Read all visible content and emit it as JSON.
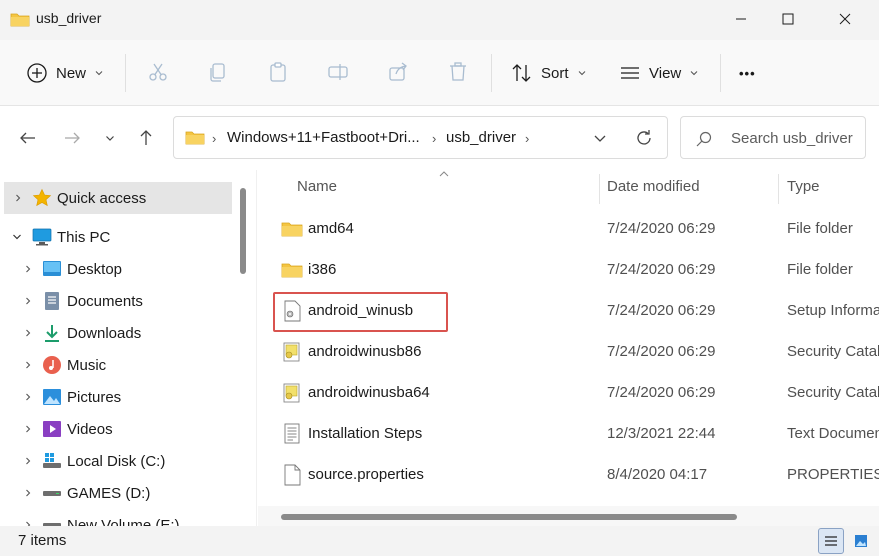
{
  "window": {
    "title": "usb_driver"
  },
  "toolbar": {
    "new_label": "New",
    "sort_label": "Sort",
    "view_label": "View",
    "more_label": "•••"
  },
  "address": {
    "crumbs": [
      "Windows+11+Fastboot+Dri...",
      "usb_driver"
    ],
    "search_placeholder": "Search usb_driver"
  },
  "nav": {
    "items": [
      {
        "label": "Quick access",
        "icon": "star-icon"
      },
      {
        "label": "This PC",
        "icon": "computer-icon"
      },
      {
        "label": "Desktop",
        "icon": "desktop-icon"
      },
      {
        "label": "Documents",
        "icon": "documents-icon"
      },
      {
        "label": "Downloads",
        "icon": "downloads-icon"
      },
      {
        "label": "Music",
        "icon": "music-icon"
      },
      {
        "label": "Pictures",
        "icon": "pictures-icon"
      },
      {
        "label": "Videos",
        "icon": "videos-icon"
      },
      {
        "label": "Local Disk (C:)",
        "icon": "disk-icon"
      },
      {
        "label": "GAMES (D:)",
        "icon": "disk-icon"
      },
      {
        "label": "New Volume (E:)",
        "icon": "disk-icon"
      }
    ]
  },
  "columns": {
    "name": "Name",
    "date": "Date modified",
    "type": "Type"
  },
  "files": [
    {
      "name": "amd64",
      "date": "7/24/2020 06:29",
      "type": "File folder",
      "icon": "folder-icon"
    },
    {
      "name": "i386",
      "date": "7/24/2020 06:29",
      "type": "File folder",
      "icon": "folder-icon"
    },
    {
      "name": "android_winusb",
      "date": "7/24/2020 06:29",
      "type": "Setup Informa",
      "icon": "setup-file-icon"
    },
    {
      "name": "androidwinusb86",
      "date": "7/24/2020 06:29",
      "type": "Security Catalo",
      "icon": "security-catalog-icon"
    },
    {
      "name": "androidwinusba64",
      "date": "7/24/2020 06:29",
      "type": "Security Catalo",
      "icon": "security-catalog-icon"
    },
    {
      "name": "Installation Steps",
      "date": "12/3/2021 22:44",
      "type": "Text Documen",
      "icon": "text-document-icon"
    },
    {
      "name": "source.properties",
      "date": "8/4/2020 04:17",
      "type": "PROPERTIES F",
      "icon": "blank-file-icon"
    }
  ],
  "status": {
    "count": "7 items"
  },
  "colors": {
    "folder": "#f4c542",
    "highlight": "#d9534f",
    "accent": "#0067c0"
  }
}
